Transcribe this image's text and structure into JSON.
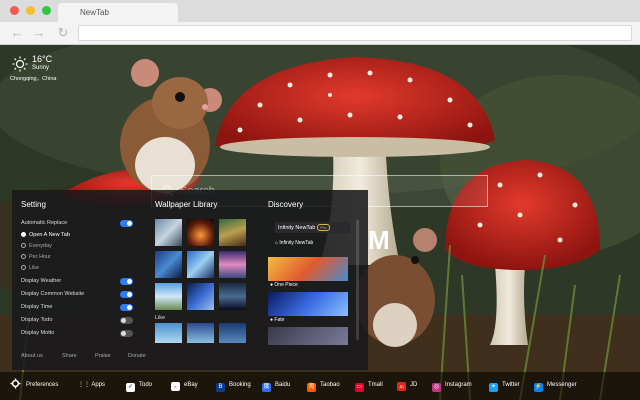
{
  "browser": {
    "tab_title": "NewTab",
    "back_icon": "arrow-left-icon",
    "forward_icon": "arrow-right-icon",
    "reload_icon": "reload-icon"
  },
  "weather": {
    "temperature": "16°C",
    "condition": "Sunny",
    "location": "Chongqing，China",
    "icon": "sun-icon"
  },
  "search": {
    "placeholder": "Search"
  },
  "clock_partial": "M",
  "settings": {
    "title": "Setting",
    "automatic_replace": "Automatic Replace",
    "options": [
      "Open A New Tab",
      "Everyday",
      "Per Hour",
      "Like"
    ],
    "toggles": [
      {
        "label": "Display Weather",
        "on": true
      },
      {
        "label": "Display Common Website",
        "on": true
      },
      {
        "label": "Display Time",
        "on": true
      },
      {
        "label": "Display Todo",
        "on": false
      },
      {
        "label": "Display Motto",
        "on": false
      }
    ],
    "footer": [
      "About us",
      "Share",
      "Praise",
      "Donate"
    ]
  },
  "library": {
    "title": "Wallpaper Library",
    "like_label": "Like"
  },
  "discovery": {
    "title": "Discovery",
    "header_name": "Infinity NewTab",
    "header_badge": "Pro",
    "sub_label": "Infinity NewTab",
    "items": [
      "One Piece",
      "Fate"
    ]
  },
  "bottom_bar": {
    "preferences": "Preferences",
    "apps": "Apps",
    "links": [
      {
        "label": "Todo",
        "color": "#ffffff"
      },
      {
        "label": "eBay",
        "color": "#ffffff"
      },
      {
        "label": "Booking",
        "color": "#0a3d91"
      },
      {
        "label": "Baidu",
        "color": "#2d6cf3"
      },
      {
        "label": "Taobao",
        "color": "#ff5a00"
      },
      {
        "label": "Tmall",
        "color": "#e4002b"
      },
      {
        "label": "JD",
        "color": "#e1251b"
      },
      {
        "label": "Instagram",
        "color": "#c13584"
      },
      {
        "label": "Twitter",
        "color": "#1da1f2"
      },
      {
        "label": "Messenger",
        "color": "#0084ff"
      }
    ]
  }
}
